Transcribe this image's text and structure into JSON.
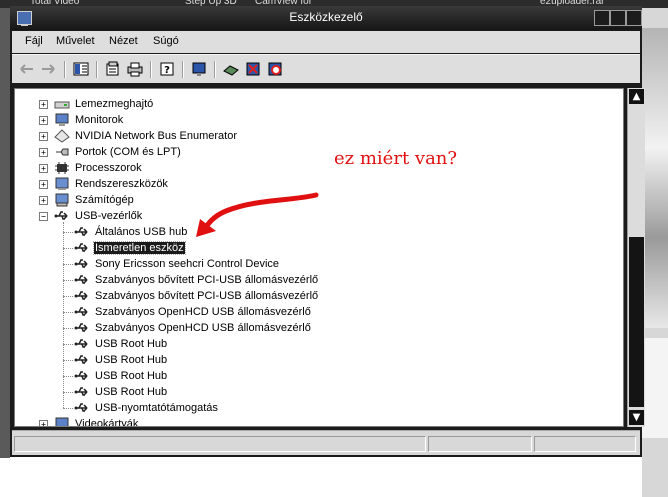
{
  "background": {
    "taskbar_items": [
      "Total Video",
      "Step Up 3D",
      "CamView for",
      "e2uploader.rar"
    ]
  },
  "window": {
    "title": "Eszközkezelő",
    "menu": [
      "Fájl",
      "Művelet",
      "Nézet",
      "Súgó"
    ],
    "toolbar": [
      "back-icon",
      "forward-icon",
      "show-hide-tree-icon",
      "properties-icon",
      "print-icon",
      "help-icon",
      "monitor-icon",
      "update-driver-icon",
      "uninstall-icon",
      "disable-icon"
    ]
  },
  "tree": {
    "categories_top": [
      {
        "label": "Lemezmeghajtó",
        "icon": "disk-drive-icon"
      },
      {
        "label": "Monitorok",
        "icon": "monitor-icon"
      },
      {
        "label": "NVIDIA Network Bus Enumerator",
        "icon": "network-bus-icon"
      },
      {
        "label": "Portok (COM és LPT)",
        "icon": "port-icon"
      },
      {
        "label": "Processzorok",
        "icon": "processor-icon"
      },
      {
        "label": "Rendszereszközök",
        "icon": "system-device-icon"
      },
      {
        "label": "Számítógép",
        "icon": "computer-icon"
      }
    ],
    "usb_category": {
      "label": "USB-vezérlők",
      "icon": "usb-icon"
    },
    "usb_children": [
      {
        "label": "Általános USB hub",
        "selected": false
      },
      {
        "label": "Ismeretlen eszköz",
        "selected": true
      },
      {
        "label": "Sony Ericsson seehcri Control Device",
        "selected": false
      },
      {
        "label": "Szabványos bővített PCI-USB állomásvezérlő",
        "selected": false
      },
      {
        "label": "Szabványos bővített PCI-USB állomásvezérlő",
        "selected": false
      },
      {
        "label": "Szabványos OpenHCD USB állomásvezérlő",
        "selected": false
      },
      {
        "label": "Szabványos OpenHCD USB állomásvezérlő",
        "selected": false
      },
      {
        "label": "USB Root Hub",
        "selected": false
      },
      {
        "label": "USB Root Hub",
        "selected": false
      },
      {
        "label": "USB Root Hub",
        "selected": false
      },
      {
        "label": "USB Root Hub",
        "selected": false
      },
      {
        "label": "USB-nyomtatótámogatás",
        "selected": false
      }
    ],
    "categories_bottom": [
      {
        "label": "Videokártyák",
        "icon": "display-adapter-icon"
      }
    ]
  },
  "annotation": {
    "text": "ez miért van?",
    "color": "#e01010"
  }
}
